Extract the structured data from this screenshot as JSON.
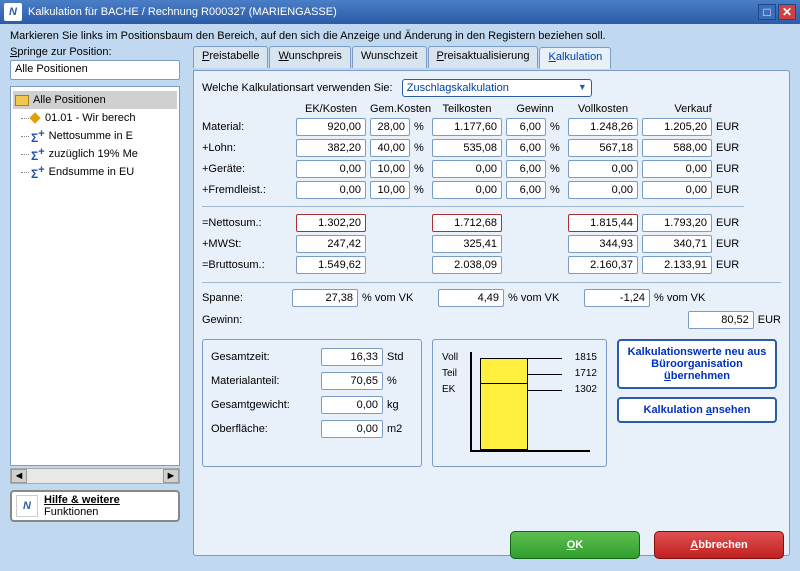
{
  "window": {
    "title": "Kalkulation für BACHE / Rechnung R000327 (MARIENGASSE)"
  },
  "instruction": "Markieren Sie links im Positionsbaum den Bereich, auf den sich die Anzeige und Änderung in den Registern beziehen soll.",
  "jump": {
    "label": "Springe zur Position:",
    "value": "Alle Positionen"
  },
  "tree": {
    "root": "Alle Positionen",
    "items": [
      "01.01 - Wir berech",
      "Nettosumme in E",
      "zuzüglich 19% Me",
      "Endsumme in EU"
    ]
  },
  "help": {
    "line1": "Hilfe & weitere",
    "line2": "Funktionen"
  },
  "tabs": {
    "t1": "Preistabelle",
    "t2": "Wunschpreis",
    "t3": "Wunschzeit",
    "t4": "Preisaktualisierung",
    "t5": "Kalkulation"
  },
  "kalk": {
    "question": "Welche Kalkulationsart verwenden Sie:",
    "type": "Zuschlagskalkulation",
    "headers": {
      "h1": "EK/Kosten",
      "h2": "Gem.Kosten",
      "h3": "Teilkosten",
      "h4": "Gewinn",
      "h5": "Vollkosten",
      "h6": "Verkauf"
    },
    "rows": {
      "material": {
        "label": "Material:",
        "ek": "920,00",
        "gk": "28,00",
        "teil": "1.177,60",
        "gew": "6,00",
        "voll": "1.248,26",
        "verk": "1.205,20"
      },
      "lohn": {
        "label": "+Lohn:",
        "ek": "382,20",
        "gk": "40,00",
        "teil": "535,08",
        "gew": "6,00",
        "voll": "567,18",
        "verk": "588,00"
      },
      "geraete": {
        "label": "+Geräte:",
        "ek": "0,00",
        "gk": "10,00",
        "teil": "0,00",
        "gew": "6,00",
        "voll": "0,00",
        "verk": "0,00"
      },
      "fremd": {
        "label": "+Fremdleist.:",
        "ek": "0,00",
        "gk": "10,00",
        "teil": "0,00",
        "gew": "6,00",
        "voll": "0,00",
        "verk": "0,00"
      },
      "netto": {
        "label": "=Nettosum.:",
        "ek": "1.302,20",
        "teil": "1.712,68",
        "voll": "1.815,44",
        "verk": "1.793,20"
      },
      "mwst": {
        "label": "+MWSt:",
        "ek": "247,42",
        "teil": "325,41",
        "voll": "344,93",
        "verk": "340,71"
      },
      "brutto": {
        "label": "=Bruttosum.:",
        "ek": "1.549,62",
        "teil": "2.038,09",
        "voll": "2.160,37",
        "verk": "2.133,91"
      }
    },
    "cur": "EUR",
    "pct": "%",
    "spanne": {
      "label": "Spanne:",
      "v1": "27,38",
      "s": "% vom VK",
      "v2": "4,49",
      "v3": "-1,24"
    },
    "gewinn": {
      "label": "Gewinn:",
      "val": "80,52"
    }
  },
  "summary": {
    "zeit": {
      "l": "Gesamtzeit:",
      "v": "16,33",
      "u": "Std"
    },
    "mat": {
      "l": "Materialanteil:",
      "v": "70,65",
      "u": "%"
    },
    "gew": {
      "l": "Gesamtgewicht:",
      "v": "0,00",
      "u": "kg"
    },
    "ob": {
      "l": "Oberfläche:",
      "v": "0,00",
      "u": "m2"
    }
  },
  "chart": {
    "voll": "Voll",
    "teil": "Teil",
    "ek": "EK",
    "v1": "1815",
    "v2": "1712",
    "v3": "1302"
  },
  "chart_data": {
    "type": "bar",
    "categories": [
      "EK",
      "Teil",
      "Voll"
    ],
    "values": [
      1302,
      1712,
      1815
    ],
    "title": "",
    "xlabel": "",
    "ylabel": "",
    "ylim": [
      0,
      1815
    ]
  },
  "actions": {
    "recalc": "Kalkulationswerte neu aus Büroorganisation übernehmen",
    "view": "Kalkulation ansehen"
  },
  "buttons": {
    "ok": "OK",
    "cancel": "Abbrechen"
  }
}
